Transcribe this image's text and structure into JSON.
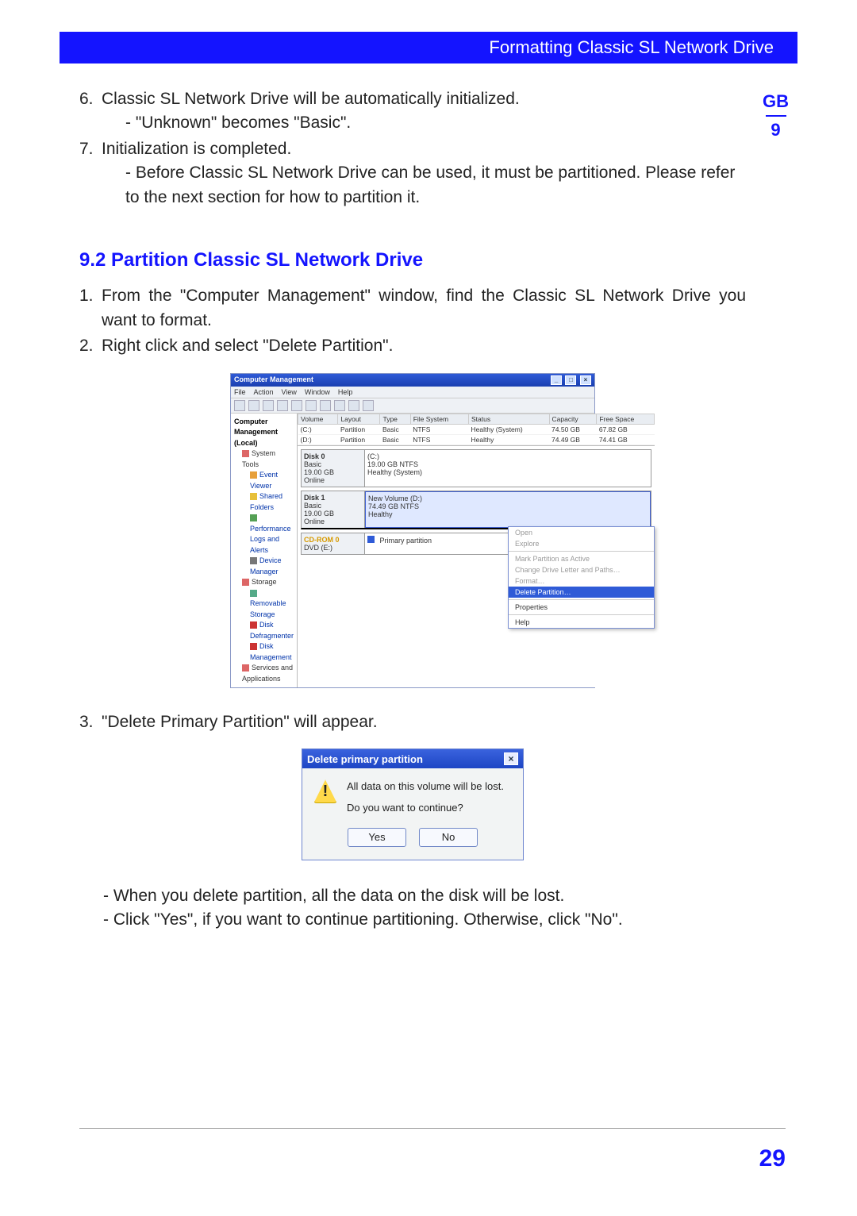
{
  "header": {
    "title": "Formatting Classic SL Network Drive"
  },
  "side_tab": {
    "lang": "GB",
    "chapter": "9"
  },
  "intro_list": {
    "item6_num": "6.",
    "item6_text": "Classic SL Network Drive will be automatically initialized.",
    "item6_sub": "- \"Unknown\"  becomes \"Basic\".",
    "item7_num": "7.",
    "item7_text": "Initialization is completed.",
    "item7_sub": "- Before Classic SL Network Drive can be used, it must be partitioned. Please refer to the next section for how to partition it."
  },
  "section": {
    "heading": "9.2 Partition Classic SL Network Drive",
    "step1_num": "1.",
    "step1_text": "From the \"Computer Management\" window, find the Classic SL Network Drive you want to format.",
    "step2_num": "2.",
    "step2_text": "Right click and select \"Delete Partition\".",
    "step3_num": "3.",
    "step3_text": "\"Delete Primary Partition\" will appear.",
    "notes_a": "- When you delete partition, all the data on the disk will be lost.",
    "notes_b": "- Click \"Yes\", if you want to continue partitioning. Otherwise, click \"No\"."
  },
  "cmw": {
    "title": "Computer Management",
    "menu": [
      "File",
      "Action",
      "View",
      "Window",
      "Help"
    ],
    "tree": {
      "root": "Computer Management (Local)",
      "sys_tools": "System Tools",
      "event": "Event Viewer",
      "shared": "Shared Folders",
      "perf": "Performance Logs and Alerts",
      "devmgr": "Device Manager",
      "storage": "Storage",
      "removable": "Removable Storage",
      "defrag": "Disk Defragmenter",
      "diskmgmt": "Disk Management",
      "services": "Services and Applications"
    },
    "grid": {
      "headers": [
        "Volume",
        "Layout",
        "Type",
        "File System",
        "Status",
        "Capacity",
        "Free Space"
      ],
      "rows": [
        [
          "(C:)",
          "Partition",
          "Basic",
          "NTFS",
          "Healthy (System)",
          "74.50 GB",
          "67.82 GB"
        ],
        [
          "(D:)",
          "Partition",
          "Basic",
          "NTFS",
          "Healthy",
          "74.49 GB",
          "74.41 GB"
        ]
      ]
    },
    "disk0": {
      "label": "Disk 0",
      "kind": "Basic",
      "size": "19.00 GB",
      "state": "Online",
      "vol": "(C:)",
      "vol_size": "19.00 GB NTFS",
      "vol_status": "Healthy (System)"
    },
    "disk1": {
      "label": "Disk 1",
      "kind": "Basic",
      "size": "19.00 GB",
      "state": "Online",
      "vol": "New Volume (D:)",
      "vol_size": "74.49 GB NTFS",
      "vol_status": "Healthy"
    },
    "cd": {
      "label": "CD-ROM 0",
      "kind": "DVD (E:)",
      "legend": "Primary partition"
    },
    "ctx": {
      "open": "Open",
      "explore": "Explore",
      "mark": "Mark Partition as Active",
      "change": "Change Drive Letter and Paths…",
      "format": "Format…",
      "delete": "Delete Partition…",
      "props": "Properties",
      "help": "Help"
    }
  },
  "dlg": {
    "title": "Delete primary partition",
    "line1": "All data on this volume will be lost.",
    "line2": "Do you want to continue?",
    "yes": "Yes",
    "no": "No"
  },
  "page_number": "29"
}
